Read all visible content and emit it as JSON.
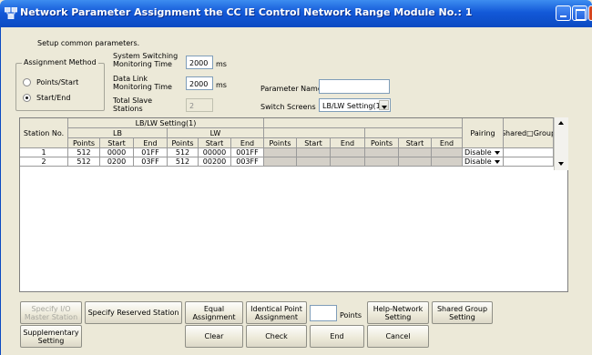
{
  "window": {
    "title": "Network Parameter  Assignment the CC IE Control Network Range Module No.: 1"
  },
  "setup_text": "Setup common parameters.",
  "assignment_method": {
    "label": "Assignment Method",
    "options": [
      "Points/Start",
      "Start/End"
    ],
    "selected": "Start/End"
  },
  "system_switching": {
    "label": "System Switching\nMonitoring Time",
    "value": "2000",
    "unit": "ms"
  },
  "data_link": {
    "label": "Data Link\nMonitoring Time",
    "value": "2000",
    "unit": "ms"
  },
  "total_slave": {
    "label": "Total Slave\nStations",
    "value": "2"
  },
  "parameter_name": {
    "label": "Parameter Name",
    "value": ""
  },
  "switch_screens": {
    "label": "Switch Screens",
    "value": "LB/LW Setting(1)"
  },
  "table": {
    "station_header": "Station No.",
    "group_header": "LB/LW Setting(1)",
    "lb_header": "LB",
    "lw_header": "LW",
    "pairing_header": "Pairing",
    "shared_header": "Shared□Group",
    "sub_headers": [
      "Points",
      "Start",
      "End",
      "Points",
      "Start",
      "End",
      "Points",
      "Start",
      "End",
      "Points",
      "Start",
      "End"
    ],
    "rows": [
      {
        "station": "1",
        "lb_points": "512",
        "lb_start": "0000",
        "lb_end": "01FF",
        "lw_points": "512",
        "lw_start": "00000",
        "lw_end": "001FF",
        "pairing": "Disable",
        "shared": ""
      },
      {
        "station": "2",
        "lb_points": "512",
        "lb_start": "0200",
        "lb_end": "03FF",
        "lw_points": "512",
        "lw_start": "00200",
        "lw_end": "003FF",
        "pairing": "Disable",
        "shared": ""
      }
    ]
  },
  "buttons": {
    "specify_io": "Specify I/O\nMaster Station",
    "specify_reserved": "Specify Reserved Station",
    "equal_assignment": "Equal\nAssignment",
    "identical_point": "Identical Point\nAssignment",
    "points_label": "Points",
    "points_value": "",
    "help_network": "Help-Network\nSetting",
    "shared_group": "Shared Group\nSetting",
    "supplementary": "Supplementary\nSetting",
    "clear": "Clear",
    "check": "Check",
    "end": "End",
    "cancel": "Cancel"
  }
}
